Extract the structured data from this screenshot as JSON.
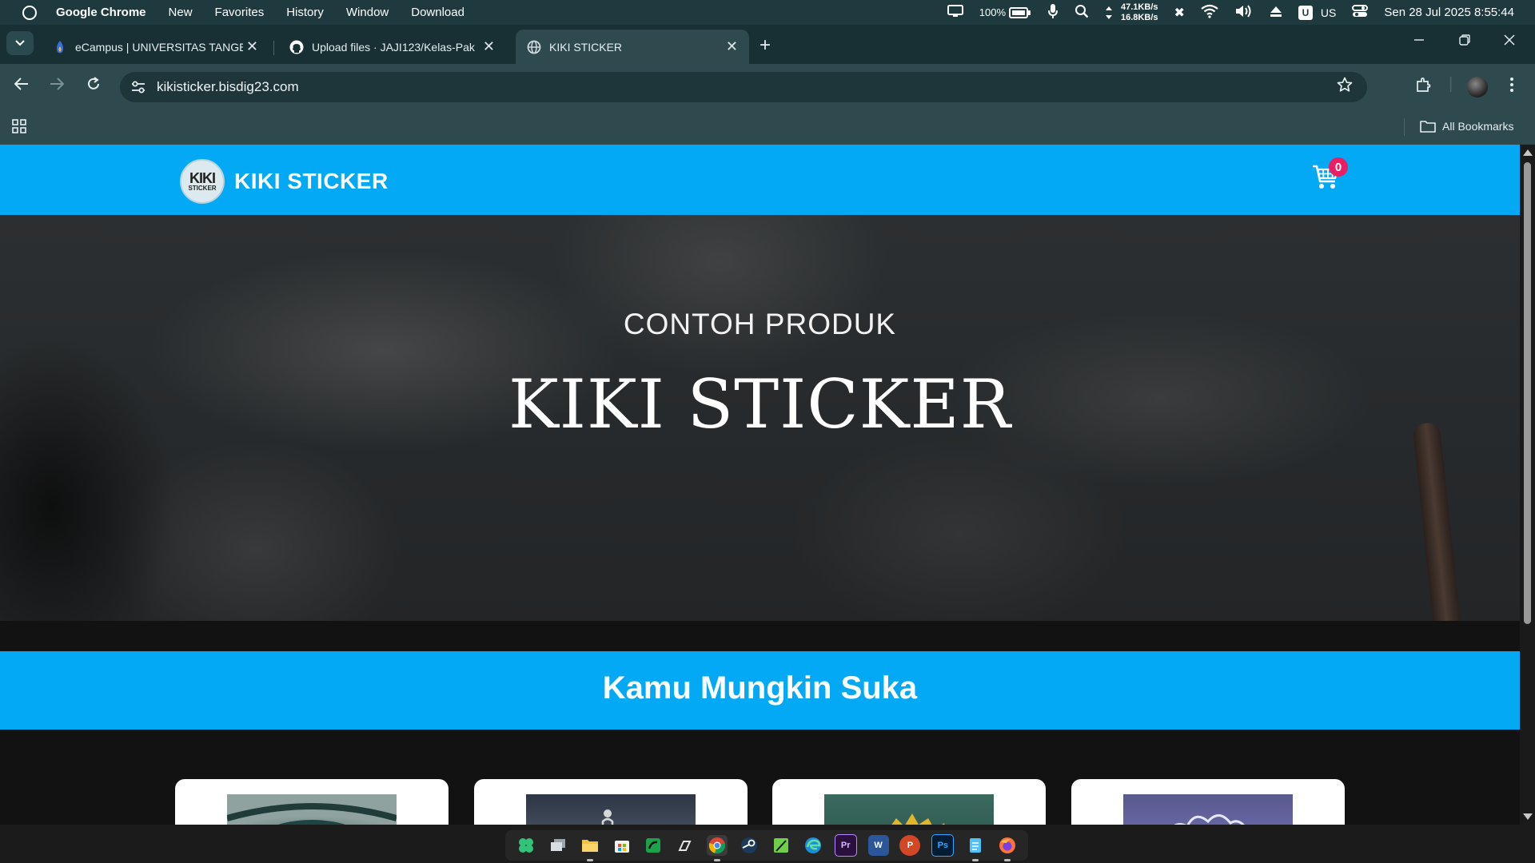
{
  "os_menubar": {
    "app_name": "Google Chrome",
    "menu": [
      "New",
      "Favorites",
      "History",
      "Window",
      "Download"
    ],
    "battery": "100%",
    "net_up": "47.1KB/s",
    "net_down": "16.8KB/s",
    "keyboard_layout": "US",
    "keyboard_badge": "U",
    "datetime": "Sen 28 Jul 2025 8:55:44"
  },
  "tabs": [
    {
      "title": "eCampus | UNIVERSITAS TANGERANG",
      "icon": "ecampus-icon",
      "active": false
    },
    {
      "title": "Upload files · JAJI123/Kelas-Pak",
      "icon": "github-icon",
      "active": false
    },
    {
      "title": "KIKI STICKER",
      "icon": "globe-icon",
      "active": true
    }
  ],
  "address_bar": {
    "url": "kikisticker.bisdig23.com"
  },
  "bookmarks": {
    "all_bookmarks_label": "All Bookmarks"
  },
  "site": {
    "brand_name": "KIKI STICKER",
    "logo_line1": "KIKI",
    "logo_line2": "STICKER",
    "cart_count": "0",
    "hero_subtitle": "CONTOH PRODUK",
    "hero_title": "KIKI STICKER",
    "section_title": "Kamu Mungkin Suka",
    "product_cards": [
      {
        "thumb_color": "#4f6e6b"
      },
      {
        "thumb_color": "#3c4755"
      },
      {
        "thumb_color": "#3e6a5f"
      },
      {
        "thumb_color": "#4b4b86"
      }
    ]
  },
  "colors": {
    "brand_blue": "#03a9f4",
    "cart_badge": "#e91e63",
    "browser_frame": "#2e4a4f"
  },
  "taskbar_apps": [
    "clover-icon",
    "task-view-icon",
    "file-explorer-icon",
    "store-icon",
    "sheets-icon",
    "pen-icon",
    "chrome-icon",
    "steam-icon",
    "feather-icon",
    "edge-icon",
    "premiere-icon",
    "word-icon",
    "powerpoint-icon",
    "photoshop-icon",
    "notepad-icon",
    "firefox-icon"
  ]
}
